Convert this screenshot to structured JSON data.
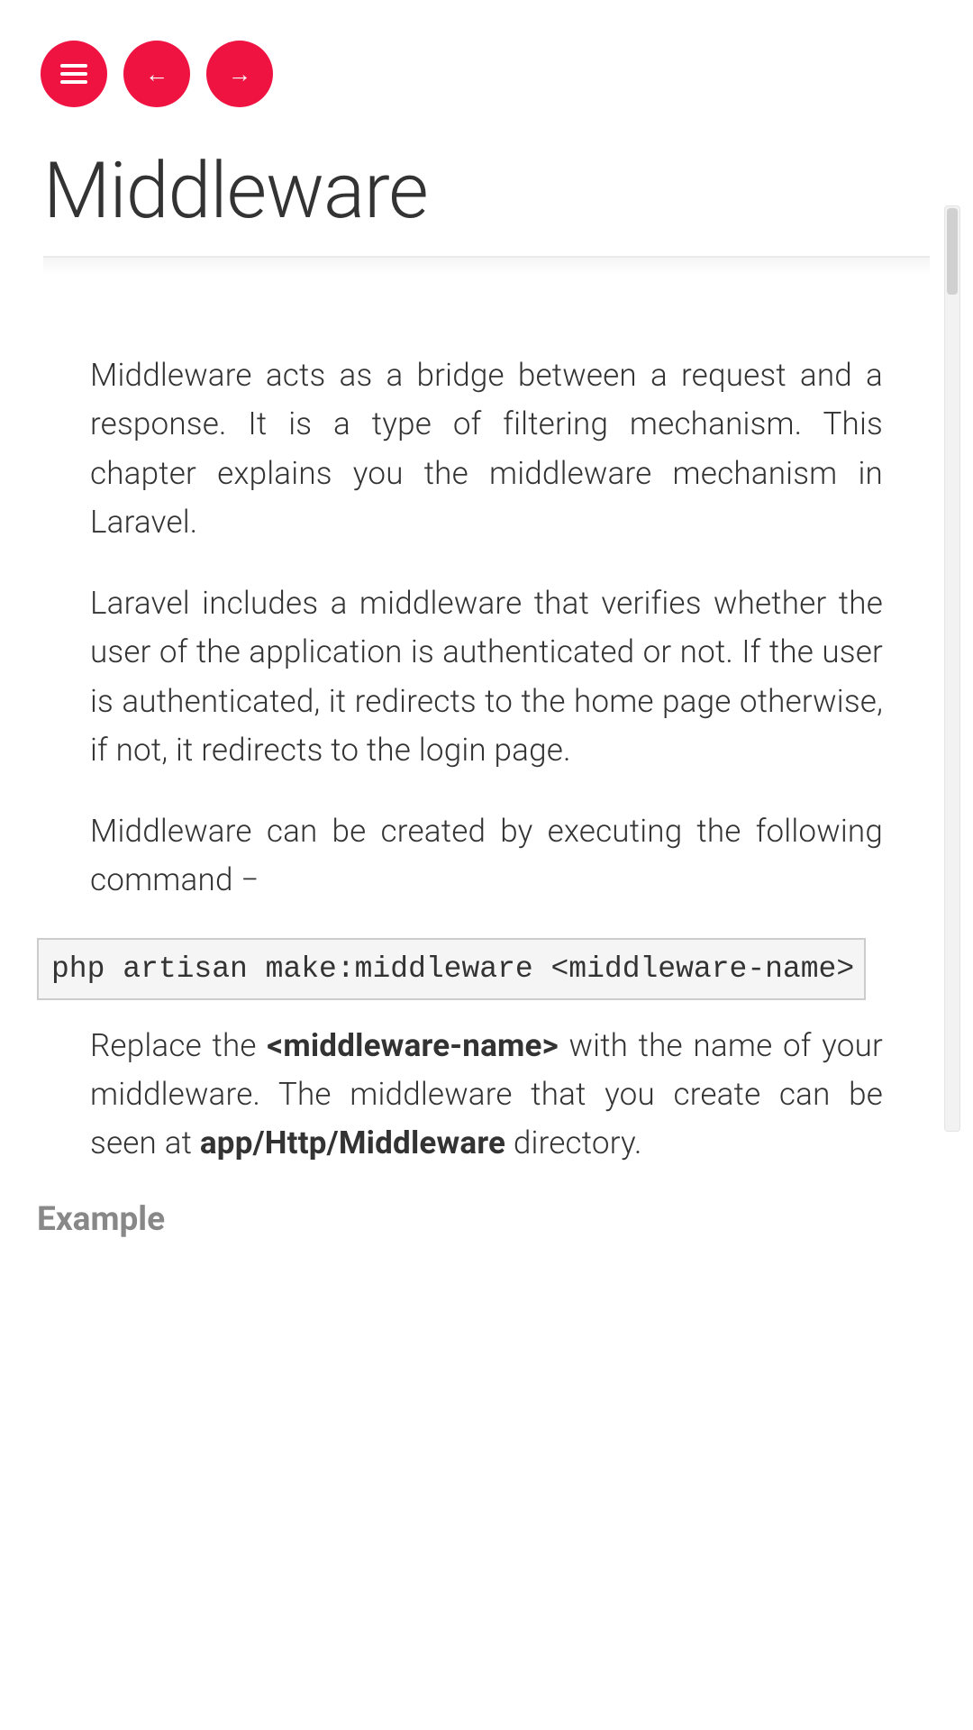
{
  "header": {
    "title": "Middleware"
  },
  "content": {
    "para1": "Middleware acts as a bridge between a request and a response. It is a type of filtering mechanism. This chapter explains you the middleware mechanism in Laravel.",
    "para2": "Laravel includes a middleware that verifies whether the user of the application is authenticated or not. If the user is authenticated, it redirects to the home page otherwise, if not, it redirects to the login page.",
    "para3": "Middleware can be created by executing the following command −",
    "code1": "php artisan make:middleware <middleware-name>",
    "para4_part1": "Replace the ",
    "para4_bold1": "<middleware-name>",
    "para4_part2": " with the name of your middleware. The middleware that you create can be seen at ",
    "para4_bold2": "app/Http/Middleware",
    "para4_part3": " directory.",
    "heading_example": "Example"
  }
}
